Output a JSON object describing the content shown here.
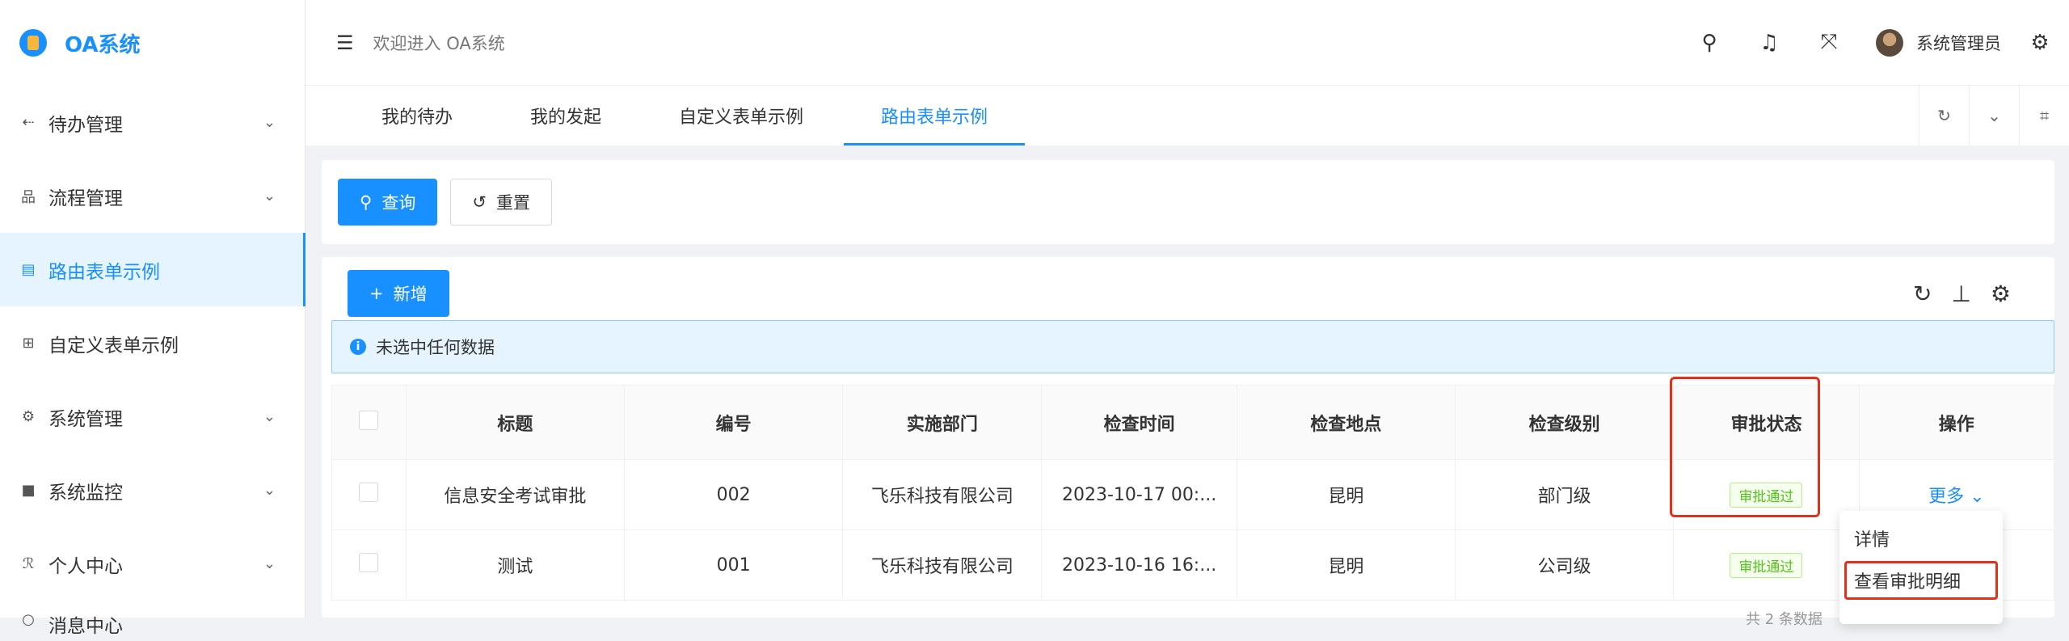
{
  "app": {
    "name": "OA系统"
  },
  "sidebar": {
    "items": [
      {
        "icon": "todo-icon",
        "glyph": "⇠",
        "label": "待办管理",
        "caret": "⌄"
      },
      {
        "icon": "flow-icon",
        "glyph": "品",
        "label": "流程管理",
        "caret": "⌄"
      },
      {
        "icon": "form-icon",
        "glyph": "▤",
        "label": "路由表单示例",
        "caret": ""
      },
      {
        "icon": "grid-icon",
        "glyph": "⊞",
        "label": "自定义表单示例",
        "caret": ""
      },
      {
        "icon": "gear-icon",
        "glyph": "⚙",
        "label": "系统管理",
        "caret": "⌄"
      },
      {
        "icon": "monitor-icon",
        "glyph": "■",
        "label": "系统监控",
        "caret": "⌄"
      },
      {
        "icon": "user-icon",
        "glyph": "ℛ",
        "label": "个人中心",
        "caret": "⌄"
      },
      {
        "icon": "message-icon",
        "glyph": "○",
        "label": "消息中心",
        "caret": ""
      }
    ]
  },
  "header": {
    "welcome": "欢迎进入 OA系统",
    "username": "系统管理员"
  },
  "tabs": [
    {
      "label": "我的待办"
    },
    {
      "label": "我的发起"
    },
    {
      "label": "自定义表单示例"
    },
    {
      "label": "路由表单示例"
    }
  ],
  "search": {
    "query_label": "查询",
    "reset_label": "重置"
  },
  "toolbar": {
    "add_label": "新增"
  },
  "alert": {
    "text": "未选中任何数据"
  },
  "table": {
    "columns": [
      "标题",
      "编号",
      "实施部门",
      "检查时间",
      "检查地点",
      "检查级别",
      "审批状态",
      "操作"
    ],
    "rows": [
      {
        "title": "信息安全考试审批",
        "code": "002",
        "dept": "飞乐科技有限公司",
        "time": "2023-10-17 00:...",
        "place": "昆明",
        "level": "部门级",
        "status": "审批通过",
        "action": "更多"
      },
      {
        "title": "测试",
        "code": "001",
        "dept": "飞乐科技有限公司",
        "time": "2023-10-16 16:...",
        "place": "昆明",
        "level": "公司级",
        "status": "审批通过",
        "action": ""
      }
    ]
  },
  "dropdown": {
    "items": [
      "详情",
      "查看审批明细"
    ]
  },
  "pager": {
    "hint": "共 2 条数据"
  }
}
